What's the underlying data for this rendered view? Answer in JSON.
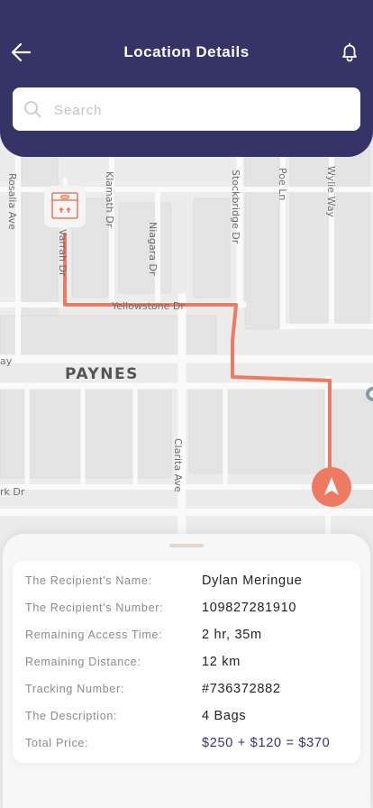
{
  "header": {
    "title": "Location Details"
  },
  "search": {
    "placeholder": "Search"
  },
  "map": {
    "streets": [
      "Rosalia Ave",
      "Klamath Dr",
      "Niagara Dr",
      "Stockbridge Dr",
      "Poe Ln",
      "Wylie Way",
      "Yellowstone Dr",
      "Clarita Ave",
      "rk Dr",
      "ay",
      "Varrah Dr"
    ],
    "area": "PAYNES",
    "route_color": "#ee7a62",
    "accent": "#363466"
  },
  "details": {
    "rows": [
      {
        "label": "The Recipient's Name:",
        "value": "Dylan Meringue"
      },
      {
        "label": "The Recipient's Number:",
        "value": "109827281910"
      },
      {
        "label": "Remaining Access Time:",
        "value": "2 hr, 35m"
      },
      {
        "label": "Remaining Distance:",
        "value": "12 km"
      },
      {
        "label": "Tracking Number:",
        "value": "#736372882"
      },
      {
        "label": "The Description:",
        "value": "4 Bags"
      },
      {
        "label": "Total Price:",
        "value": "$250 + $120 = $370"
      }
    ]
  }
}
